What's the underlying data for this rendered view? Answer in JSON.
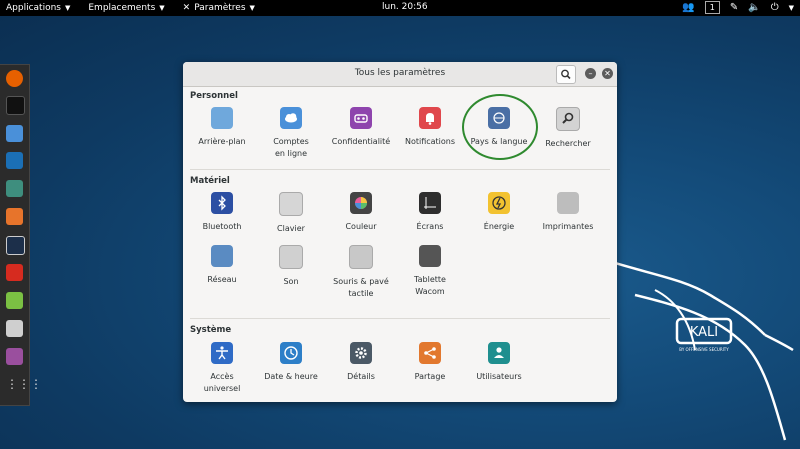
{
  "topbar": {
    "menus": [
      {
        "label": "Applications"
      },
      {
        "label": "Emplacements"
      },
      {
        "label": "Paramètres"
      }
    ],
    "clock": "lun. 20:56",
    "workspace": "1"
  },
  "window": {
    "title": "Tous les paramètres",
    "sections": [
      {
        "title": "Personnel",
        "items": [
          {
            "label": "Arrière-plan",
            "icon": "background-icon",
            "color": "#6fa8dc"
          },
          {
            "label": "Comptes en ligne",
            "icon": "cloud-icon",
            "color": "#4a90d9"
          },
          {
            "label": "Confidentialité",
            "icon": "privacy-mask-icon",
            "color": "#8e44ad"
          },
          {
            "label": "Notifications",
            "icon": "bell-icon",
            "color": "#e0474c"
          },
          {
            "label": "Pays & langue",
            "icon": "globe-flag-icon",
            "color": "#4a6fa5"
          },
          {
            "label": "Rechercher",
            "icon": "magnifier-icon",
            "color": "#d3d3d3"
          }
        ]
      },
      {
        "title": "Matériel",
        "items": [
          {
            "label": "Bluetooth",
            "icon": "bluetooth-icon",
            "color": "#2c4fa3"
          },
          {
            "label": "Clavier",
            "icon": "keyboard-icon",
            "color": "#d6d6d6"
          },
          {
            "label": "Couleur",
            "icon": "color-wheel-icon",
            "color": "#444444"
          },
          {
            "label": "Écrans",
            "icon": "display-icon",
            "color": "#2e2e2e"
          },
          {
            "label": "Énergie",
            "icon": "power-bolt-icon",
            "color": "#f2c230"
          },
          {
            "label": "Imprimantes",
            "icon": "printer-icon",
            "color": "#bdbdbd"
          },
          {
            "label": "Réseau",
            "icon": "network-folder-icon",
            "color": "#5a8bc2"
          },
          {
            "label": "Son",
            "icon": "speaker-icon",
            "color": "#d0d0d0"
          },
          {
            "label": "Souris & pavé tactile",
            "icon": "mouse-icon",
            "color": "#c8c8c8"
          },
          {
            "label": "Tablette Wacom",
            "icon": "tablet-icon",
            "color": "#555555"
          }
        ]
      },
      {
        "title": "Système",
        "items": [
          {
            "label": "Accès universel",
            "icon": "accessibility-icon",
            "color": "#2f6bc6"
          },
          {
            "label": "Date & heure",
            "icon": "clock-icon",
            "color": "#2d7fc8"
          },
          {
            "label": "Détails",
            "icon": "gear-icon",
            "color": "#4b5966"
          },
          {
            "label": "Partage",
            "icon": "share-icon",
            "color": "#e2782e"
          },
          {
            "label": "Utilisateurs",
            "icon": "user-icon",
            "color": "#1f8f8f"
          }
        ]
      }
    ]
  },
  "wallpaper": {
    "logo_text": "KALI",
    "logo_sub": "BY OFFENSIVE SECURITY"
  }
}
